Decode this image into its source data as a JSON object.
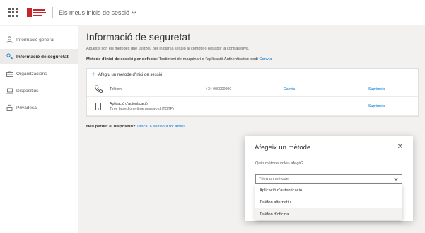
{
  "header": {
    "app_title": "Els meus inicis de sessió",
    "icons": [
      "waffle-icon",
      "logo",
      "chevron-down-icon"
    ]
  },
  "sidebar": {
    "items": [
      {
        "label": "Informació general",
        "icon": "person-icon",
        "active": false
      },
      {
        "label": "Informació de seguretat",
        "icon": "key-icon",
        "active": true
      },
      {
        "label": "Organitzacions",
        "icon": "briefcase-icon",
        "active": false
      },
      {
        "label": "Dispositius",
        "icon": "laptop-icon",
        "active": false
      },
      {
        "label": "Privadesa",
        "icon": "lock-icon",
        "active": false
      }
    ]
  },
  "main": {
    "title": "Informació de seguretat",
    "description": "Aquests són els mètodes que utilitzeu per iniciar la sessió al compte o restablir la contrasenya.",
    "default_method_label": "Mètode d'inici de sessió per defecte:",
    "default_method_value": "Testimoni de maquinari o l'aplicació Authenticator: codi",
    "default_method_link": "Canvia",
    "add_method_label": "Afegiu un mètode d'inici de sessió",
    "methods": [
      {
        "name": "Telèfon",
        "detail": "",
        "value": "+34 000000000",
        "change": "Canvia",
        "delete": "Suprimeix",
        "icon": "phone-icon"
      },
      {
        "name": "Aplicació d'autenticació",
        "detail": "Time based one-time password (TOTP)",
        "value": "",
        "change": "",
        "delete": "Suprimeix",
        "icon": "mobile-icon"
      }
    ],
    "lost_device_question": "Heu perdut el dispositiu?",
    "lost_device_link": "Tanca la sessió a tot arreu"
  },
  "dialog": {
    "title": "Afegeix un mètode",
    "close_symbol": "✕",
    "question": "Quin mètode voleu afegir?",
    "select_placeholder": "Trieu un mètode",
    "options": [
      "Aplicació d'autenticació",
      "Telèfon alternatiu",
      "Telèfon d'oficina"
    ],
    "hovered_option": "Telèfon d'oficina"
  },
  "colors": {
    "accent": "#0078d4",
    "background": "#f2f1f0",
    "brand_red": "#c4262e"
  }
}
